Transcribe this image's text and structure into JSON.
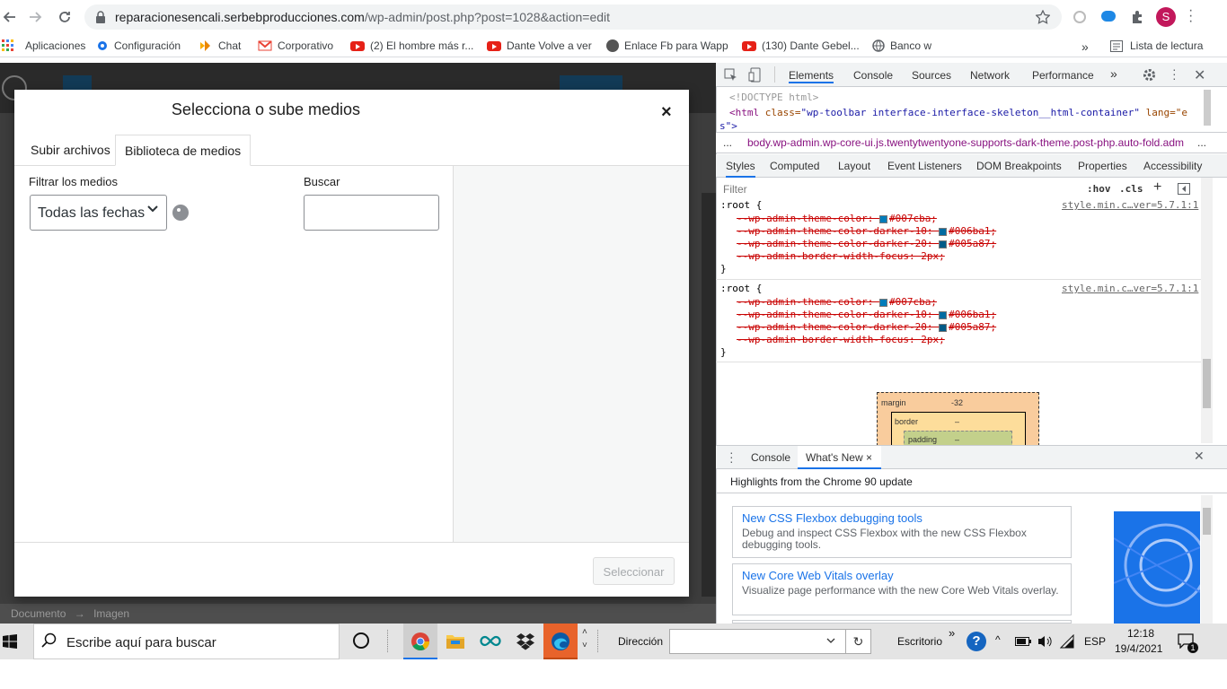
{
  "browser": {
    "url_host": "reparacionesencali.serbebproducciones.com",
    "url_path": "/wp-admin/post.php?post=1028&action=edit",
    "profile_initial": "S",
    "bookmarks": [
      {
        "label": "Aplicaciones"
      },
      {
        "label": "Configuración"
      },
      {
        "label": "Chat"
      },
      {
        "label": "Corporativo"
      },
      {
        "label": "(2) El hombre más r..."
      },
      {
        "label": "Dante Volve a ver"
      },
      {
        "label": "Enlace Fb para Wapp"
      },
      {
        "label": "(130) Dante Gebel..."
      },
      {
        "label": "Banco w"
      }
    ],
    "more_bookmarks": "»",
    "reading_list": "Lista de lectura"
  },
  "modal": {
    "title": "Selecciona o sube medios",
    "close": "×",
    "tab_upload": "Subir archivos",
    "tab_library": "Biblioteca de medios",
    "filter_label": "Filtrar los medios",
    "date_filter_value": "Todas las fechas",
    "search_label": "Buscar",
    "search_value": "",
    "select_button": "Seleccionar"
  },
  "wp_footer": {
    "crumb1": "Documento",
    "arrow": "→",
    "crumb2": "Imagen"
  },
  "devtools": {
    "tabs": [
      "Elements",
      "Console",
      "Sources",
      "Network",
      "Performance"
    ],
    "more": "»",
    "doctype": "<!DOCTYPE html>",
    "html_open": "<html",
    "html_class_attr": "class=",
    "html_class_val": "\"wp-toolbar interface-interface-skeleton__html-container\"",
    "html_lang": "lang=\"e",
    "html_lang2": "s\">",
    "breadcrumb": "body.wp-admin.wp-core-ui.js.twentytwentyone-supports-dark-theme.post-php.auto-fold.adm",
    "breadcrumb_dots": "...",
    "styles_tabs": [
      "Styles",
      "Computed",
      "Layout",
      "Event Listeners",
      "DOM Breakpoints",
      "Properties",
      "Accessibility"
    ],
    "filter_placeholder": "Filter",
    "hov": ":hov",
    "cls": ".cls",
    "rule1": {
      "selector": ":root {",
      "source": "style.min.c…ver=5.7.1:1",
      "props": [
        {
          "text": "--wp-admin-theme-color: ",
          "value": "#007cba;",
          "color": "#007cba"
        },
        {
          "text": "--wp-admin-theme-color-darker-10: ",
          "value": "#006ba1;",
          "color": "#006ba1"
        },
        {
          "text": "--wp-admin-theme-color-darker-20: ",
          "value": "#005a87;",
          "color": "#005a87"
        },
        {
          "text": "--wp-admin-border-width-focus: 2px;",
          "value": "",
          "color": ""
        }
      ],
      "close": "}"
    },
    "rule2": {
      "selector": ":root {",
      "source": "style.min.c…ver=5.7.1:1",
      "props": [
        {
          "text": "--wp-admin-theme-color: ",
          "value": "#007cba;",
          "color": "#007cba"
        },
        {
          "text": "--wp-admin-theme-color-darker-10: ",
          "value": "#006ba1;",
          "color": "#006ba1"
        },
        {
          "text": "--wp-admin-theme-color-darker-20: ",
          "value": "#005a87;",
          "color": "#005a87"
        },
        {
          "text": "--wp-admin-border-width-focus: 2px;",
          "value": "",
          "color": ""
        }
      ],
      "close": "}"
    },
    "box_model": {
      "margin_label": "margin",
      "margin_value": "-32",
      "border_label": "border",
      "border_value": "–",
      "padding_label": "padding",
      "padding_value": "–"
    },
    "drawer_tabs": [
      "Console",
      "What's New"
    ],
    "drawer_close_tab": "×",
    "whats_new_heading": "Highlights from the Chrome 90 update",
    "cards": [
      {
        "title": "New CSS Flexbox debugging tools",
        "desc": "Debug and inspect CSS Flexbox with the new CSS Flexbox debugging tools."
      },
      {
        "title": "New Core Web Vitals overlay",
        "desc": "Visualize page performance with the new Core Web Vitals overlay."
      }
    ]
  },
  "taskbar": {
    "search_placeholder": "Escribe aquí para buscar",
    "address_label": "Dirección",
    "desktop_label": "Escritorio",
    "toolbar_more": "»",
    "language": "ESP",
    "time": "12:18",
    "date": "19/4/2021",
    "notification_count": "1"
  }
}
